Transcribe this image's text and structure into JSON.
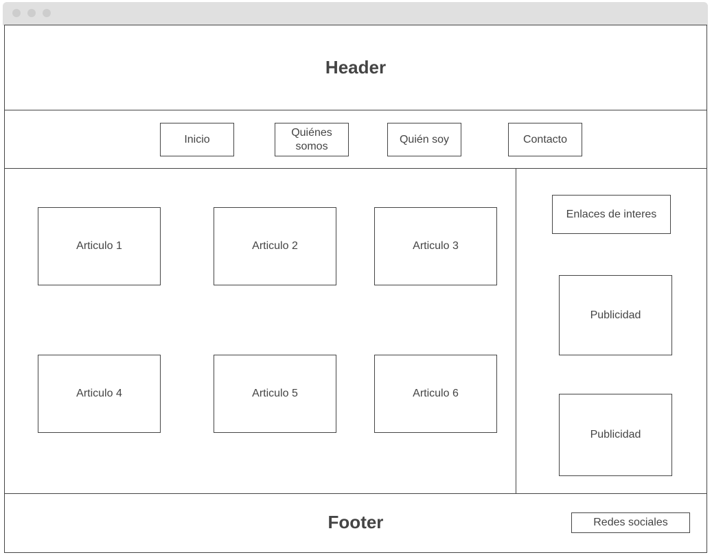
{
  "header": {
    "title": "Header"
  },
  "nav": {
    "items": [
      {
        "label": "Inicio"
      },
      {
        "label": "Quiénes somos"
      },
      {
        "label": "Quién soy"
      },
      {
        "label": "Contacto"
      }
    ]
  },
  "main": {
    "articles": [
      {
        "label": "Articulo 1"
      },
      {
        "label": "Articulo 2"
      },
      {
        "label": "Articulo 3"
      },
      {
        "label": "Articulo 4"
      },
      {
        "label": "Articulo 5"
      },
      {
        "label": "Articulo 6"
      }
    ]
  },
  "sidebar": {
    "links_label": "Enlaces de interes",
    "ads": [
      {
        "label": "Publicidad"
      },
      {
        "label": "Publicidad"
      }
    ]
  },
  "footer": {
    "title": "Footer",
    "social_label": "Redes sociales"
  }
}
